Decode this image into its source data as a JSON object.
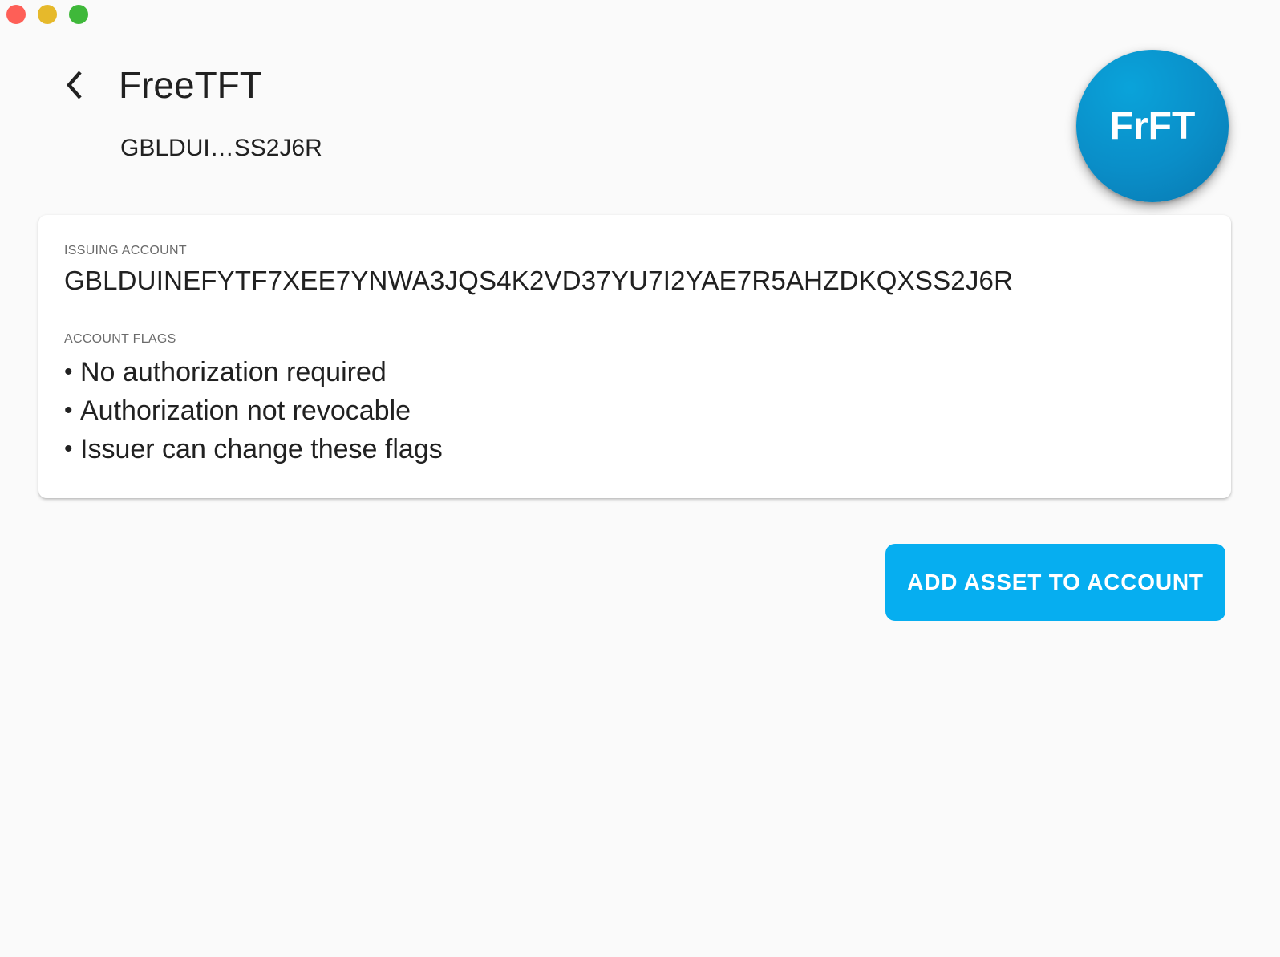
{
  "window": {
    "traffic_lights": [
      "close",
      "minimize",
      "zoom"
    ]
  },
  "header": {
    "back_icon": "chevron-left-icon",
    "title": "FreeTFT",
    "subtitle": "GBLDUI…SS2J6R",
    "avatar_text": "FrFT",
    "avatar_color": "#0a8ec8"
  },
  "details": {
    "issuing_account_label": "ISSUING ACCOUNT",
    "issuing_account_value": "GBLDUINEFYTF7XEE7YNWA3JQS4K2VD37YU7I2YAE7R5AHZDKQXSS2J6R",
    "account_flags_label": "ACCOUNT FLAGS",
    "flags": [
      "No authorization required",
      "Authorization not revocable",
      "Issuer can change these flags"
    ]
  },
  "actions": {
    "add_asset_label": "ADD ASSET TO ACCOUNT",
    "add_asset_color": "#06aef0"
  }
}
